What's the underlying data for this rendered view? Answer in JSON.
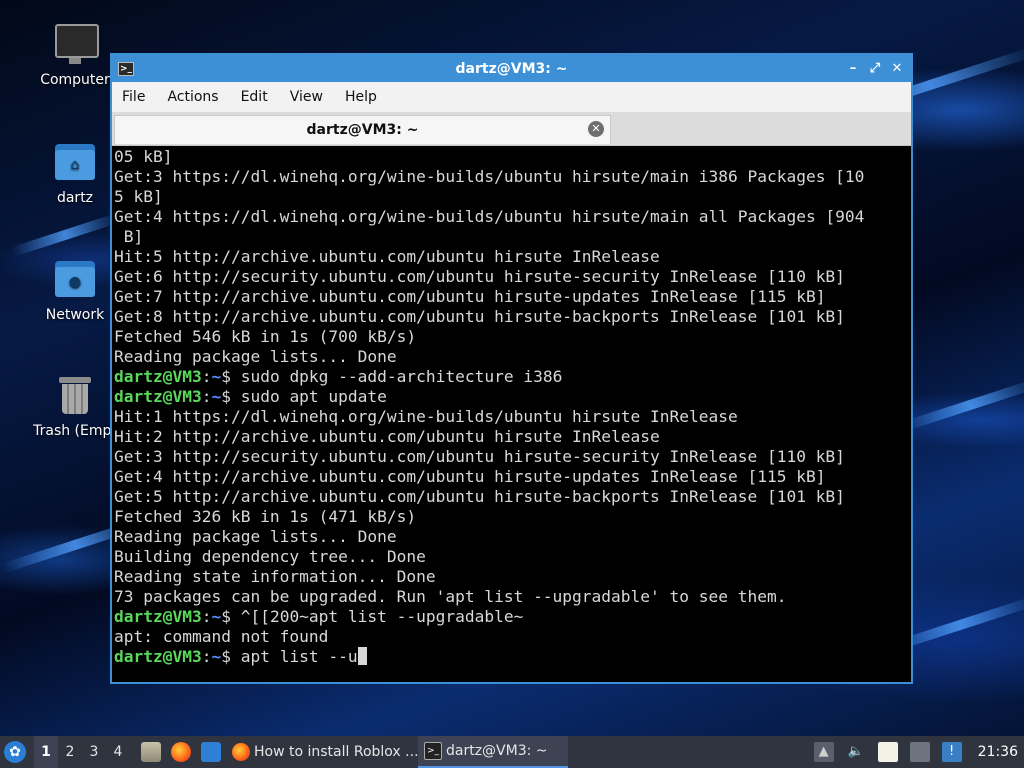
{
  "desktop": {
    "icons": [
      {
        "label": "Computer",
        "icon": "computer-icon"
      },
      {
        "label": "dartz",
        "icon": "home-folder-icon"
      },
      {
        "label": "Network",
        "icon": "network-folder-icon"
      },
      {
        "label": "Trash (Empt",
        "icon": "trash-icon"
      }
    ]
  },
  "window": {
    "title": "dartz@VM3: ~",
    "menus": [
      "File",
      "Actions",
      "Edit",
      "View",
      "Help"
    ],
    "tab_label": "dartz@VM3: ~"
  },
  "terminal": {
    "lines": [
      {
        "text": "05 kB]"
      },
      {
        "text": "Get:3 https://dl.winehq.org/wine-builds/ubuntu hirsute/main i386 Packages [10"
      },
      {
        "text": "5 kB]"
      },
      {
        "text": "Get:4 https://dl.winehq.org/wine-builds/ubuntu hirsute/main all Packages [904"
      },
      {
        "text": " B]"
      },
      {
        "text": "Hit:5 http://archive.ubuntu.com/ubuntu hirsute InRelease"
      },
      {
        "text": "Get:6 http://security.ubuntu.com/ubuntu hirsute-security InRelease [110 kB]"
      },
      {
        "text": "Get:7 http://archive.ubuntu.com/ubuntu hirsute-updates InRelease [115 kB]"
      },
      {
        "text": "Get:8 http://archive.ubuntu.com/ubuntu hirsute-backports InRelease [101 kB]"
      },
      {
        "text": "Fetched 546 kB in 1s (700 kB/s)"
      },
      {
        "text": "Reading package lists... Done"
      },
      {
        "prompt": true,
        "user": "dartz@VM3",
        "path": "~",
        "cmd": "$ sudo dpkg --add-architecture i386"
      },
      {
        "prompt": true,
        "user": "dartz@VM3",
        "path": "~",
        "cmd": "$ sudo apt update"
      },
      {
        "text": "Hit:1 https://dl.winehq.org/wine-builds/ubuntu hirsute InRelease"
      },
      {
        "text": "Hit:2 http://archive.ubuntu.com/ubuntu hirsute InRelease"
      },
      {
        "text": "Get:3 http://security.ubuntu.com/ubuntu hirsute-security InRelease [110 kB]"
      },
      {
        "text": "Get:4 http://archive.ubuntu.com/ubuntu hirsute-updates InRelease [115 kB]"
      },
      {
        "text": "Get:5 http://archive.ubuntu.com/ubuntu hirsute-backports InRelease [101 kB]"
      },
      {
        "text": "Fetched 326 kB in 1s (471 kB/s)"
      },
      {
        "text": "Reading package lists... Done"
      },
      {
        "text": "Building dependency tree... Done"
      },
      {
        "text": "Reading state information... Done"
      },
      {
        "text": "73 packages can be upgraded. Run 'apt list --upgradable' to see them."
      },
      {
        "prompt": true,
        "user": "dartz@VM3",
        "path": "~",
        "cmd": "$ ^[[200~apt list --upgradable~"
      },
      {
        "text": "apt: command not found"
      },
      {
        "prompt": true,
        "user": "dartz@VM3",
        "path": "~",
        "cmd": "$ apt list --u",
        "cursor": true
      }
    ]
  },
  "taskbar": {
    "workspaces": [
      "1",
      "2",
      "3",
      "4"
    ],
    "active_workspace": "1",
    "tasks": [
      {
        "label": "How to install Roblox ...",
        "icon": "firefox-icon",
        "active": false
      },
      {
        "label": "dartz@VM3: ~",
        "icon": "terminal-icon",
        "active": true
      }
    ],
    "clock": "21:36"
  },
  "colors": {
    "title_bar": "#3d8fd6",
    "prompt_user": "#5ad85a",
    "prompt_path": "#5a8cff",
    "taskbar": "#2f343f"
  }
}
